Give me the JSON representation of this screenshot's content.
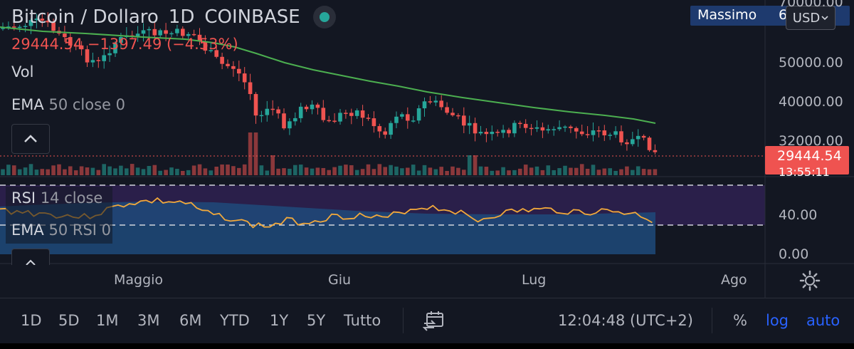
{
  "header": {
    "symbol": "Bitcoin / Dollaro",
    "interval": "1D",
    "exchange": "COINBASE",
    "status_color": "#26a69a"
  },
  "quote": {
    "text": "29444.54 −1397.49 (−4.53%)"
  },
  "indicators": {
    "volume_label": "Vol",
    "ema_name": "EMA",
    "ema_params": "50 close 0",
    "rsi_name": "RSI",
    "rsi_params": "14 close",
    "rsi_ema_name": "EMA",
    "rsi_ema_params": "50 RSI 0"
  },
  "account": {
    "user": "Massimo",
    "count_partial": "6",
    "currency": "USD"
  },
  "price_axis": {
    "labels": [
      "70000.00",
      "50000.00",
      "40000.00",
      "32000.00"
    ],
    "last_price": "29444.54",
    "countdown": "13:55:11"
  },
  "rsi_axis": {
    "labels": [
      "40.00",
      "0.00"
    ]
  },
  "time_axis": {
    "labels": [
      "Maggio",
      "Giu",
      "Lug",
      "Ago"
    ]
  },
  "toolbar": {
    "ranges": [
      "1D",
      "5D",
      "1M",
      "3M",
      "6M",
      "YTD",
      "1Y",
      "5Y",
      "Tutto"
    ],
    "clock": "12:04:48 (UTC+2)",
    "percent_label": "%",
    "log_label": "log",
    "auto_label": "auto"
  },
  "icons": {
    "collapse": "chevron-up-icon",
    "settings": "gear-icon",
    "compare": "compare-arrows-icon",
    "currency_dropdown": "chevron-down-icon"
  },
  "colors": {
    "background": "#131722",
    "up": "#26a69a",
    "down": "#ef5350",
    "ema_line": "#4caf50",
    "rsi_line": "#f2a93b",
    "rsi_band": "#2a1f4a",
    "rsi_fill": "#1e4a7a",
    "accent": "#2962ff"
  }
}
